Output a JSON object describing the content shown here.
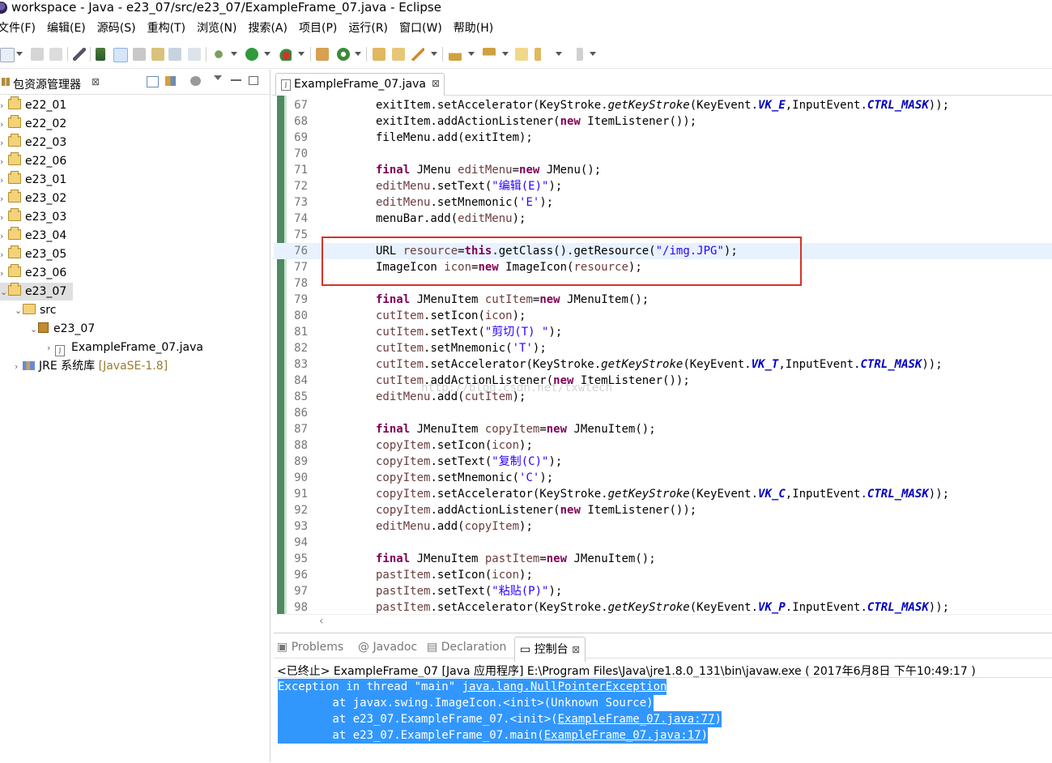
{
  "window": {
    "title": "workspace - Java - e23_07/src/e23_07/ExampleFrame_07.java - Eclipse"
  },
  "menu": [
    "文件(F)",
    "编辑(E)",
    "源码(S)",
    "重构(T)",
    "浏览(N)",
    "搜索(A)",
    "项目(P)",
    "运行(R)",
    "窗口(W)",
    "帮助(H)"
  ],
  "explorer": {
    "tab_label": "包资源管理器",
    "close_glyph": "⊠",
    "items": [
      {
        "label": "e22_01",
        "arrow": "›"
      },
      {
        "label": "e22_02",
        "arrow": "›"
      },
      {
        "label": "e22_03",
        "arrow": "›"
      },
      {
        "label": "e22_06",
        "arrow": "›"
      },
      {
        "label": "e23_01",
        "arrow": "›"
      },
      {
        "label": "e23_02",
        "arrow": "›"
      },
      {
        "label": "e23_03",
        "arrow": "›"
      },
      {
        "label": "e23_04",
        "arrow": "›"
      },
      {
        "label": "e23_05",
        "arrow": "›"
      },
      {
        "label": "e23_06",
        "arrow": "›"
      },
      {
        "label": "e23_07",
        "arrow": "⌄"
      }
    ],
    "src_label": "src",
    "package_label": "e23_07",
    "file_label": "ExampleFrame_07.java",
    "jre_label": "JRE 系统库",
    "jre_version": "[JavaSE-1.8]"
  },
  "editor": {
    "tab_label": "ExampleFrame_07.java",
    "close_glyph": "⊠",
    "lines": [
      {
        "n": "67",
        "t": [
          [
            "",
            "exitItem.setAccelerator(KeyStroke."
          ],
          [
            "sm",
            "getKeyStroke"
          ],
          [
            "",
            "(KeyEvent."
          ],
          [
            "fld",
            "VK_E"
          ],
          [
            "",
            ",InputEvent."
          ],
          [
            "fld",
            "CTRL_MASK"
          ],
          [
            "",
            "));"
          ]
        ]
      },
      {
        "n": "68",
        "t": [
          [
            "",
            "exitItem.addActionListener("
          ],
          [
            "kw",
            "new"
          ],
          [
            "",
            " ItemListener());"
          ]
        ]
      },
      {
        "n": "69",
        "t": [
          [
            "",
            "fileMenu.add(exitItem);"
          ]
        ]
      },
      {
        "n": "70",
        "t": []
      },
      {
        "n": "71",
        "t": [
          [
            "kw",
            "final"
          ],
          [
            "",
            " JMenu "
          ],
          [
            "var",
            "editMenu"
          ],
          [
            "",
            "="
          ],
          [
            "kw",
            "new"
          ],
          [
            "",
            " JMenu();"
          ]
        ]
      },
      {
        "n": "72",
        "t": [
          [
            "var",
            "editMenu"
          ],
          [
            "",
            ".setText("
          ],
          [
            "str",
            "\"编辑(E)\""
          ],
          [
            "",
            ");"
          ]
        ]
      },
      {
        "n": "73",
        "t": [
          [
            "var",
            "editMenu"
          ],
          [
            "",
            ".setMnemonic("
          ],
          [
            "str",
            "'E'"
          ],
          [
            "",
            ");"
          ]
        ]
      },
      {
        "n": "74",
        "t": [
          [
            "",
            "menuBar.add("
          ],
          [
            "var",
            "editMenu"
          ],
          [
            "",
            ");"
          ]
        ]
      },
      {
        "n": "75",
        "t": []
      },
      {
        "n": "76",
        "t": [
          [
            "",
            "URL "
          ],
          [
            "var",
            "resource"
          ],
          [
            "",
            "="
          ],
          [
            "kw",
            "this"
          ],
          [
            "",
            ".getClass().getResource("
          ],
          [
            "str",
            "\"/img.JPG\""
          ],
          [
            "",
            ");"
          ]
        ],
        "hl": true
      },
      {
        "n": "77",
        "t": [
          [
            "",
            "ImageIcon "
          ],
          [
            "var",
            "icon"
          ],
          [
            "",
            "="
          ],
          [
            "kw",
            "new"
          ],
          [
            "",
            " ImageIcon("
          ],
          [
            "var",
            "resource"
          ],
          [
            "",
            ");"
          ]
        ]
      },
      {
        "n": "78",
        "t": []
      },
      {
        "n": "79",
        "t": [
          [
            "kw",
            "final"
          ],
          [
            "",
            " JMenuItem "
          ],
          [
            "var",
            "cutItem"
          ],
          [
            "",
            "="
          ],
          [
            "kw",
            "new"
          ],
          [
            "",
            " JMenuItem();"
          ]
        ]
      },
      {
        "n": "80",
        "t": [
          [
            "var",
            "cutItem"
          ],
          [
            "",
            ".setIcon("
          ],
          [
            "var",
            "icon"
          ],
          [
            "",
            ");"
          ]
        ]
      },
      {
        "n": "81",
        "t": [
          [
            "var",
            "cutItem"
          ],
          [
            "",
            ".setText("
          ],
          [
            "str",
            "\"剪切(T) \""
          ],
          [
            "",
            ");"
          ]
        ]
      },
      {
        "n": "82",
        "t": [
          [
            "var",
            "cutItem"
          ],
          [
            "",
            ".setMnemonic("
          ],
          [
            "str",
            "'T'"
          ],
          [
            "",
            ");"
          ]
        ]
      },
      {
        "n": "83",
        "t": [
          [
            "var",
            "cutItem"
          ],
          [
            "",
            ".setAccelerator(KeyStroke."
          ],
          [
            "sm",
            "getKeyStroke"
          ],
          [
            "",
            "(KeyEvent."
          ],
          [
            "fld",
            "VK_T"
          ],
          [
            "",
            ",InputEvent."
          ],
          [
            "fld",
            "CTRL_MASK"
          ],
          [
            "",
            "));"
          ]
        ]
      },
      {
        "n": "84",
        "t": [
          [
            "var",
            "cutItem"
          ],
          [
            "",
            ".addActionListener("
          ],
          [
            "kw",
            "new"
          ],
          [
            "",
            " ItemListener());"
          ]
        ]
      },
      {
        "n": "85",
        "t": [
          [
            "var",
            "editMenu"
          ],
          [
            "",
            ".add("
          ],
          [
            "var",
            "cutItem"
          ],
          [
            "",
            ");"
          ]
        ]
      },
      {
        "n": "86",
        "t": []
      },
      {
        "n": "87",
        "t": [
          [
            "kw",
            "final"
          ],
          [
            "",
            " JMenuItem "
          ],
          [
            "var",
            "copyItem"
          ],
          [
            "",
            "="
          ],
          [
            "kw",
            "new"
          ],
          [
            "",
            " JMenuItem();"
          ]
        ]
      },
      {
        "n": "88",
        "t": [
          [
            "var",
            "copyItem"
          ],
          [
            "",
            ".setIcon("
          ],
          [
            "var",
            "icon"
          ],
          [
            "",
            ");"
          ]
        ]
      },
      {
        "n": "89",
        "t": [
          [
            "var",
            "copyItem"
          ],
          [
            "",
            ".setText("
          ],
          [
            "str",
            "\"复制(C)\""
          ],
          [
            "",
            ");"
          ]
        ]
      },
      {
        "n": "90",
        "t": [
          [
            "var",
            "copyItem"
          ],
          [
            "",
            ".setMnemonic("
          ],
          [
            "str",
            "'C'"
          ],
          [
            "",
            ");"
          ]
        ]
      },
      {
        "n": "91",
        "t": [
          [
            "var",
            "copyItem"
          ],
          [
            "",
            ".setAccelerator(KeyStroke."
          ],
          [
            "sm",
            "getKeyStroke"
          ],
          [
            "",
            "(KeyEvent."
          ],
          [
            "fld",
            "VK_C"
          ],
          [
            "",
            ",InputEvent."
          ],
          [
            "fld",
            "CTRL_MASK"
          ],
          [
            "",
            "));"
          ]
        ]
      },
      {
        "n": "92",
        "t": [
          [
            "var",
            "copyItem"
          ],
          [
            "",
            ".addActionListener("
          ],
          [
            "kw",
            "new"
          ],
          [
            "",
            " ItemListener());"
          ]
        ]
      },
      {
        "n": "93",
        "t": [
          [
            "var",
            "editMenu"
          ],
          [
            "",
            ".add("
          ],
          [
            "var",
            "copyItem"
          ],
          [
            "",
            ");"
          ]
        ]
      },
      {
        "n": "94",
        "t": []
      },
      {
        "n": "95",
        "t": [
          [
            "kw",
            "final"
          ],
          [
            "",
            " JMenuItem "
          ],
          [
            "var",
            "pastItem"
          ],
          [
            "",
            "="
          ],
          [
            "kw",
            "new"
          ],
          [
            "",
            " JMenuItem();"
          ]
        ]
      },
      {
        "n": "96",
        "t": [
          [
            "var",
            "pastItem"
          ],
          [
            "",
            ".setIcon("
          ],
          [
            "var",
            "icon"
          ],
          [
            "",
            ");"
          ]
        ]
      },
      {
        "n": "97",
        "t": [
          [
            "var",
            "pastItem"
          ],
          [
            "",
            ".setText("
          ],
          [
            "str",
            "\"粘贴(P)\""
          ],
          [
            "",
            ");"
          ]
        ]
      },
      {
        "n": "98",
        "t": [
          [
            "var",
            "pastItem"
          ],
          [
            "",
            ".setAccelerator(KeyStroke."
          ],
          [
            "sm",
            "getKeyStroke"
          ],
          [
            "",
            "(KeyEvent."
          ],
          [
            "fld",
            "VK_P"
          ],
          [
            "",
            ".InputEvent."
          ],
          [
            "fld",
            "CTRL_MASK"
          ],
          [
            "",
            "));"
          ]
        ]
      }
    ],
    "watermark": "http://blog.csdn.net/txwtech",
    "scroll_left_glyph": "‹"
  },
  "bottom_panel": {
    "tabs": [
      {
        "label": "Problems",
        "glyph": "▣"
      },
      {
        "label": "Javadoc",
        "glyph": "@"
      },
      {
        "label": "Declaration",
        "glyph": "▤"
      },
      {
        "label": "控制台",
        "glyph": "▭",
        "active": true
      }
    ],
    "close_glyph": "⊠",
    "console_title": "<已终止> ExampleFrame_07 [Java 应用程序] E:\\Program Files\\Java\\jre1.8.0_131\\bin\\javaw.exe ( 2017年6月8日 下午10:49:17 )",
    "output": [
      {
        "pre": "Exception in thread \"main\" ",
        "link": "java.lang.NullPointerException",
        "post": ""
      },
      {
        "pre": "\tat javax.swing.ImageIcon.<init>(Unknown Source)",
        "link": "",
        "post": ""
      },
      {
        "pre": "\tat e23_07.ExampleFrame_07.<init>(",
        "link": "ExampleFrame_07.java:77",
        "post": ")"
      },
      {
        "pre": "\tat e23_07.ExampleFrame_07.main(",
        "link": "ExampleFrame_07.java:17",
        "post": ")"
      }
    ]
  },
  "colors": {
    "keyword": "#7f0055",
    "string": "#2a00ff",
    "field": "#0000c0",
    "local_var": "#6a3e3e",
    "highlight_box": "#d6322a",
    "console_selection": "#3297fd"
  }
}
